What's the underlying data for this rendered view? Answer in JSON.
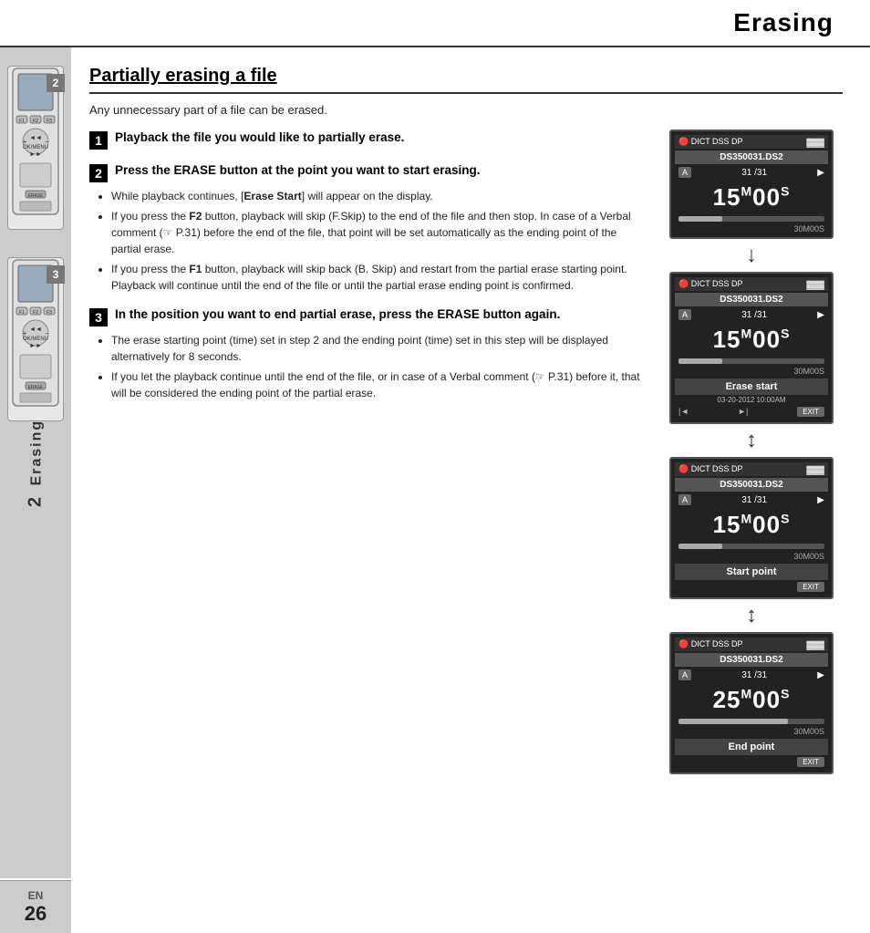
{
  "header": {
    "title": "Erasing"
  },
  "sidebar": {
    "chapter": "2",
    "label": "Erasing",
    "bottom_lang": "EN",
    "bottom_page": "26"
  },
  "section": {
    "title": "Partially erasing a file",
    "intro": "Any unnecessary part of a file can be erased."
  },
  "steps": [
    {
      "number": "1",
      "title": "Playback the file you would like to partially erase."
    },
    {
      "number": "2",
      "title": "Press the ERASE button at the point you want to start erasing.",
      "bullets": [
        "While playback continues, [Erase Start] will appear on the display.",
        "If you press the F2 button, playback will skip (F.Skip) to the end of the file and then stop. In case of a Verbal comment (☞ P.31) before the end of the file, that point will be set automatically as the ending point of the partial erase.",
        "If you press the F1 button, playback will skip back (B. Skip) and restart from the partial erase starting point.\nPlayback will continue until the end of the file or until the partial erase ending point is confirmed."
      ]
    },
    {
      "number": "3",
      "title": "In the position you want to end partial erase, press the ERASE button again.",
      "bullets": [
        "The erase starting point (time) set in step 2 and the ending point (time) set in this step will be displayed alternatively for 8 seconds.",
        "If you let the playback continue until the end of the file, or in case of a Verbal comment (☞ P.31) before it, that will be considered the ending point of the partial erase."
      ]
    }
  ],
  "screens": [
    {
      "id": "screen1",
      "icons": "REC DICT DSS DP",
      "filename": "DS350031.DS2",
      "folder": "A",
      "counter": "31 /31",
      "time": "15M00S",
      "total": "30M00S",
      "label": "",
      "date": "",
      "show_exit": false,
      "show_controls": false,
      "show_erase_start": false,
      "show_start_point": false,
      "show_end_point": false
    },
    {
      "id": "screen2",
      "icons": "REC DICT DSS DP",
      "filename": "DS350031.DS2",
      "folder": "A",
      "counter": "31 /31",
      "time": "15M00S",
      "total": "30M00S",
      "label": "Erase start",
      "date": "03-20-2012 10:00AM",
      "show_exit": true,
      "show_controls": true,
      "show_erase_start": true,
      "show_start_point": false,
      "show_end_point": false
    },
    {
      "id": "screen3",
      "icons": "REC DICT DSS DP",
      "filename": "DS350031.DS2",
      "folder": "A",
      "counter": "31 /31",
      "time": "15M00S",
      "total": "30M00S",
      "label": "Start point",
      "date": "",
      "show_exit": true,
      "show_controls": false,
      "show_erase_start": false,
      "show_start_point": true,
      "show_end_point": false
    },
    {
      "id": "screen4",
      "icons": "REC DICT DSS DP",
      "filename": "DS350031.DS2",
      "folder": "A",
      "counter": "31 /31",
      "time": "25M00S",
      "total": "30M00S",
      "label": "End point",
      "date": "",
      "show_exit": true,
      "show_controls": false,
      "show_erase_start": false,
      "show_start_point": false,
      "show_end_point": true
    }
  ],
  "device_badge_2": "2",
  "device_badge_3": "3"
}
